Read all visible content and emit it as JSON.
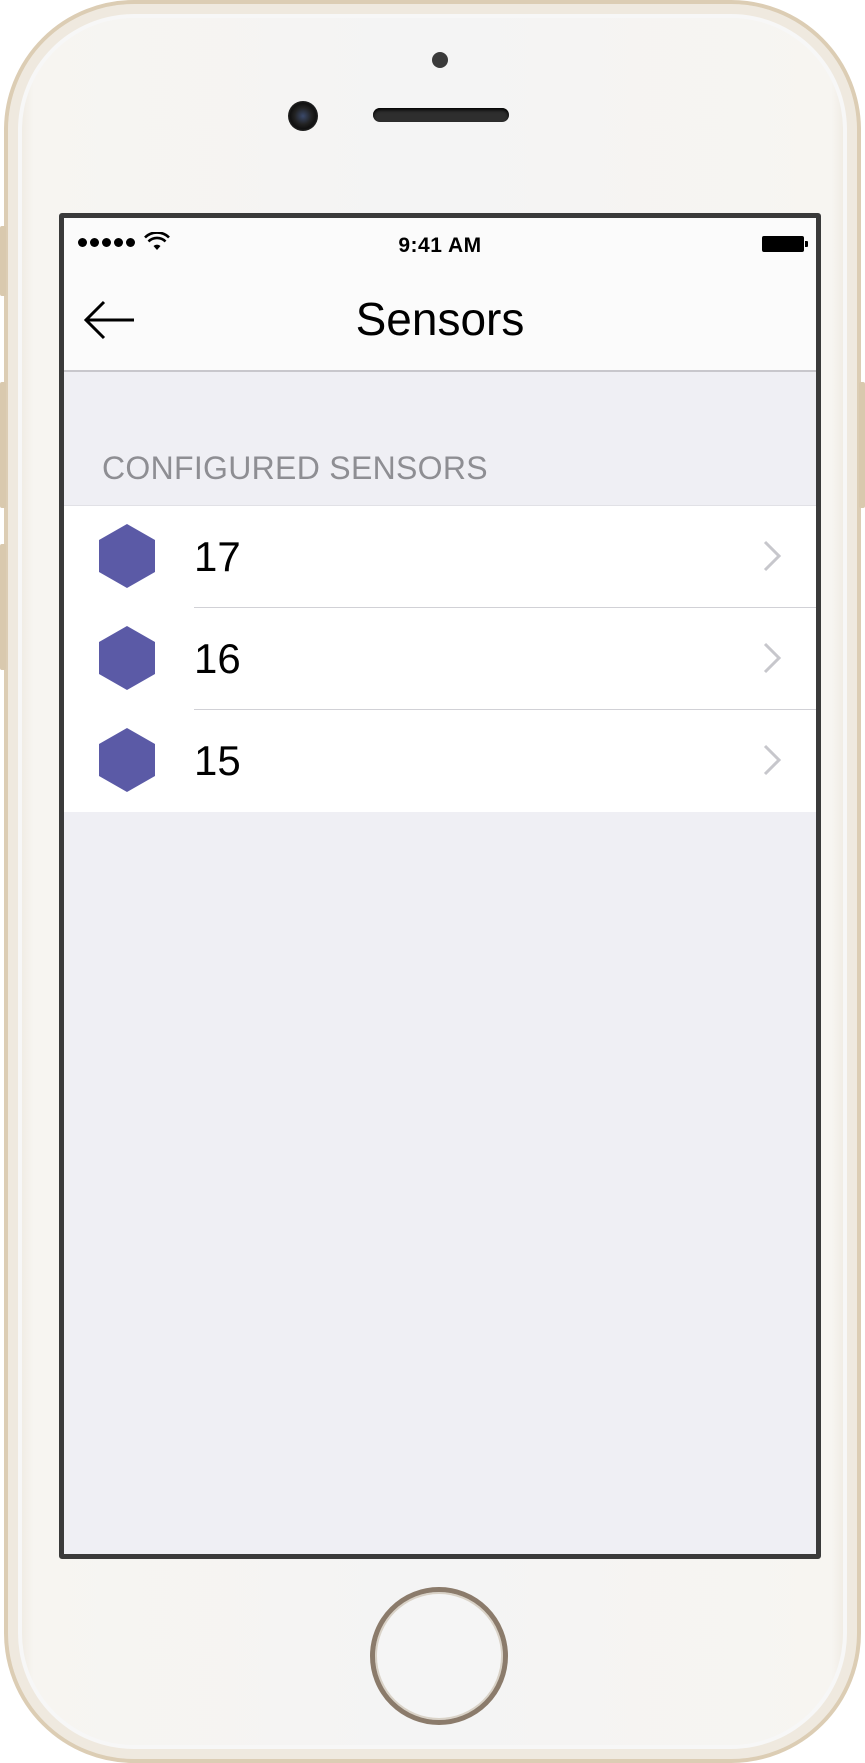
{
  "status_bar": {
    "time": "9:41 AM",
    "signal_dots": 5
  },
  "nav": {
    "title": "Sensors",
    "back_icon": "arrow-left-icon"
  },
  "section": {
    "header": "CONFIGURED SENSORS"
  },
  "sensors": [
    {
      "label": "17",
      "icon": "hexagon-icon"
    },
    {
      "label": "16",
      "icon": "hexagon-icon"
    },
    {
      "label": "15",
      "icon": "hexagon-icon"
    }
  ],
  "colors": {
    "accent": "#5b5aa6",
    "background": "#efeff4",
    "section_text": "#8e8e93",
    "chevron": "#c7c7cc"
  }
}
